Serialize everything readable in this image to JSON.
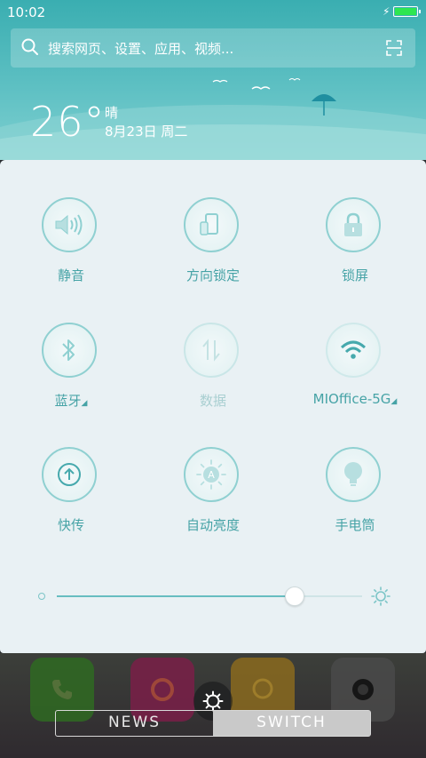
{
  "status_bar": {
    "time": "10:02",
    "battery_level": 1.0,
    "charging": true
  },
  "search": {
    "placeholder": "搜索网页、设置、应用、视频..."
  },
  "weather": {
    "temperature": "26°",
    "condition": "晴",
    "date": "8月23日 周二"
  },
  "quick_settings": [
    {
      "id": "mute",
      "label": "静音",
      "icon": "speaker-icon",
      "on": true
    },
    {
      "id": "rotation-lock",
      "label": "方向锁定",
      "icon": "rotation-lock-icon",
      "on": true
    },
    {
      "id": "lock-screen",
      "label": "锁屏",
      "icon": "lock-icon",
      "on": true
    },
    {
      "id": "bluetooth",
      "label": "蓝牙",
      "icon": "bluetooth-icon",
      "on": true,
      "expandable": true
    },
    {
      "id": "mobile-data",
      "label": "数据",
      "icon": "data-arrows-icon",
      "on": false
    },
    {
      "id": "wifi",
      "label": "MIOffice-5G",
      "icon": "wifi-icon",
      "on": true,
      "expandable": true
    },
    {
      "id": "quick-transfer",
      "label": "快传",
      "icon": "upload-icon",
      "on": true
    },
    {
      "id": "auto-brightness",
      "label": "自动亮度",
      "icon": "auto-brightness-icon",
      "on": true
    },
    {
      "id": "flashlight",
      "label": "手电筒",
      "icon": "bulb-icon",
      "on": true
    }
  ],
  "brightness": {
    "level": 0.78
  },
  "dock": {
    "apps": [
      {
        "name": "phone",
        "icon": "phone-icon",
        "color": "#3d8a2a"
      },
      {
        "name": "browser",
        "icon": "browser-icon",
        "color": "#9b2a5a"
      },
      {
        "name": "messages",
        "icon": "chat-bubble-icon",
        "color": "#b08a2a"
      },
      {
        "name": "camera",
        "icon": "camera-icon",
        "color": "#5a5a5a"
      }
    ]
  },
  "tabs": {
    "news": "NEWS",
    "switch": "SWITCH",
    "active": "switch"
  },
  "colors": {
    "accent": "#46a3a6",
    "panel": "#e9f1f4",
    "header": "#3aaeb1"
  }
}
